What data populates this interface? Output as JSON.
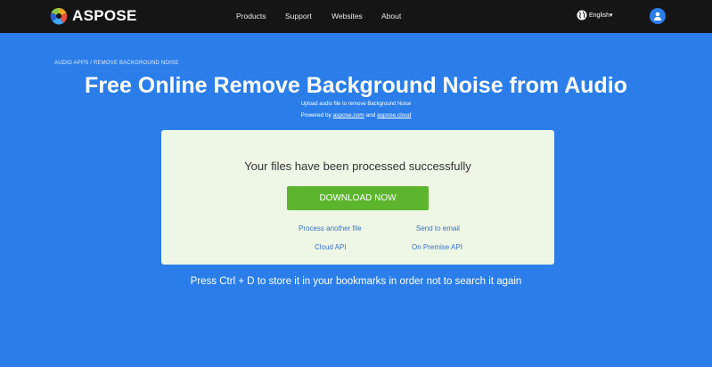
{
  "brand": {
    "name": "ASPOSE"
  },
  "nav": {
    "items": [
      {
        "label": "Products"
      },
      {
        "label": "Support"
      },
      {
        "label": "Websites"
      },
      {
        "label": "About"
      }
    ],
    "language": "English",
    "language_icon": "globe-icon",
    "user_icon": "user-icon"
  },
  "page": {
    "breadcrumb": "AUDIO APPS / REMOVE BACKGROUND NOISE",
    "title": "Free Online Remove Background Noise from Audio",
    "subtitle": "Upload audio file to remove Background Noise",
    "powered_prefix": "Powered by",
    "powered_link1": "aspose.com",
    "powered_and": "and",
    "powered_link2": "aspose.cloud"
  },
  "result": {
    "status": "Your files have been processed successfully",
    "download_label": "DOWNLOAD NOW",
    "links": {
      "process_another": "Process another file",
      "send_email": "Send to email",
      "cloud_api": "Cloud API",
      "on_premise_api": "On Premise API"
    }
  },
  "hint": "Press Ctrl + D to store it in your bookmarks in order not to search it again",
  "colors": {
    "page_bg": "#2b7ee9",
    "navbar_bg": "#151515",
    "card_bg": "#eef6e5",
    "download_bg": "#5cb52d",
    "link": "#3b74c4"
  }
}
